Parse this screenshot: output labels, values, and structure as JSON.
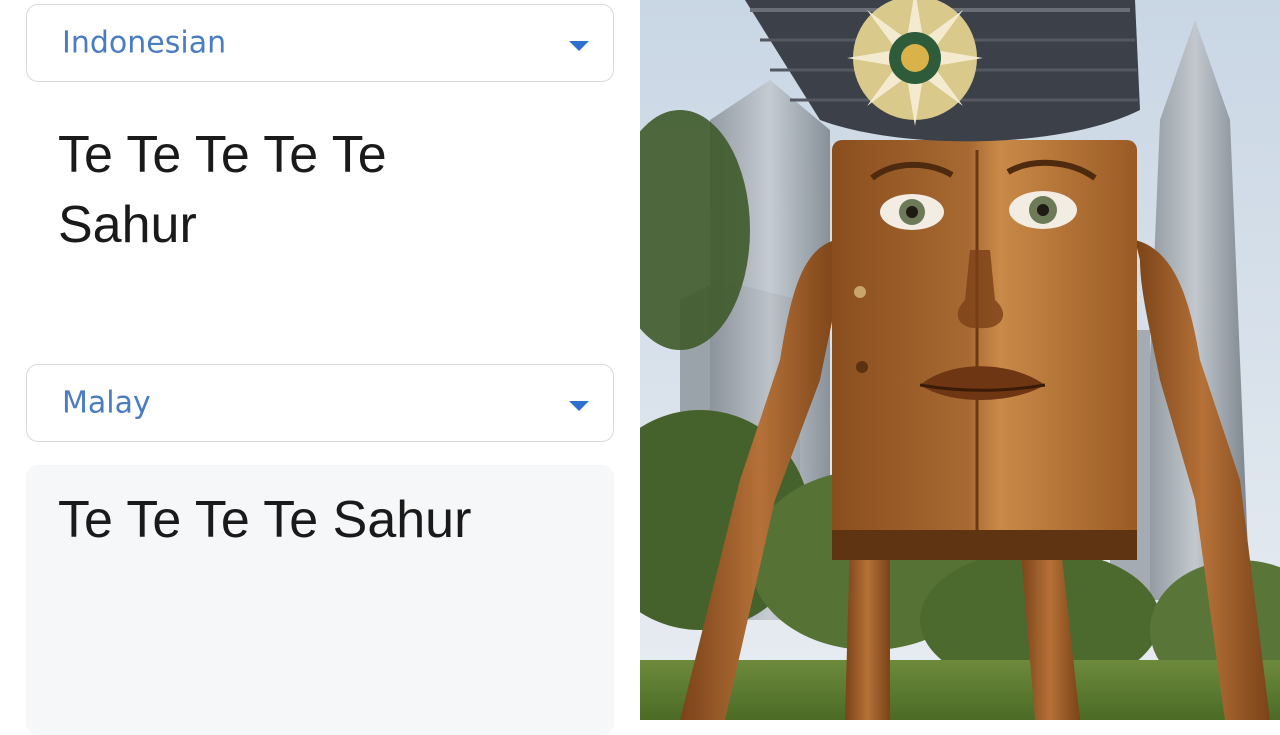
{
  "source": {
    "language": "Indonesian",
    "text": "Te Te Te Te Te Sahur"
  },
  "target": {
    "language": "Malay",
    "text": "Te Te Te Te Sahur"
  },
  "icons": {
    "dropdown": "chevron-down-icon"
  },
  "colors": {
    "language_label": "#4a7cc2",
    "dropdown_caret": "#2f6fd0",
    "text": "#1a1a1a",
    "result_background": "#f6f7f9",
    "border": "#d6d9de"
  }
}
